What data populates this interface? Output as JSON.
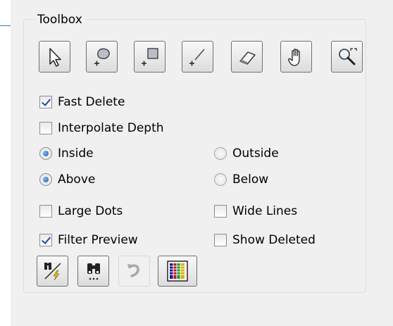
{
  "toolbox": {
    "title": "Toolbox",
    "tools": [
      {
        "name": "select",
        "icon": "arrow-pointer-icon"
      },
      {
        "name": "lasso-add",
        "icon": "lasso-add-icon"
      },
      {
        "name": "rect-add",
        "icon": "rectangle-add-icon"
      },
      {
        "name": "line-add",
        "icon": "line-add-icon"
      },
      {
        "name": "eraser",
        "icon": "eraser-icon"
      },
      {
        "name": "pan",
        "icon": "hand-icon"
      },
      {
        "name": "zoom",
        "icon": "zoom-icon"
      }
    ],
    "fast_delete": {
      "label": "Fast Delete",
      "checked": true
    },
    "interpolate_depth": {
      "label": "Interpolate Depth",
      "checked": false
    },
    "inside": {
      "label": "Inside",
      "selected": true
    },
    "outside": {
      "label": "Outside",
      "selected": false
    },
    "above": {
      "label": "Above",
      "selected": true
    },
    "below": {
      "label": "Below",
      "selected": false
    },
    "large_dots": {
      "label": "Large Dots",
      "checked": false
    },
    "wide_lines": {
      "label": "Wide Lines",
      "checked": false
    },
    "filter_preview": {
      "label": "Filter Preview",
      "checked": true
    },
    "show_deleted": {
      "label": "Show Deleted",
      "checked": false
    },
    "bottom_buttons": [
      {
        "name": "find-quick",
        "icon": "binoculars-lightning-icon",
        "enabled": true
      },
      {
        "name": "find-all",
        "icon": "binoculars-dots-icon",
        "enabled": true
      },
      {
        "name": "undo",
        "icon": "undo-icon",
        "enabled": false
      },
      {
        "name": "color-palette",
        "icon": "palette-grid-icon",
        "enabled": true
      }
    ]
  }
}
